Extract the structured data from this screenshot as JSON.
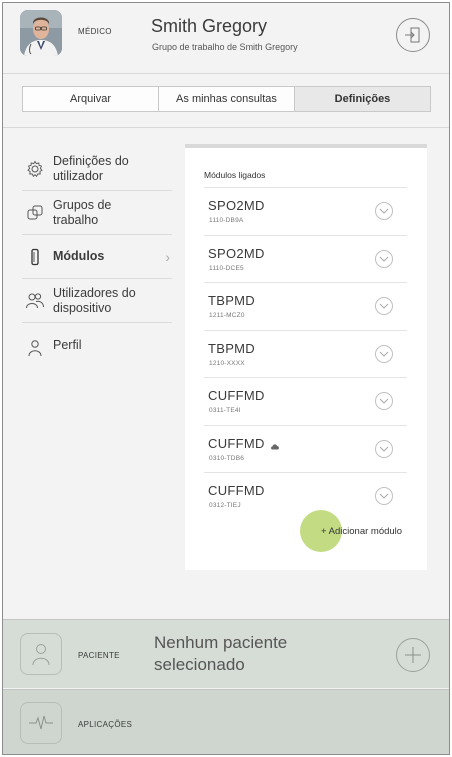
{
  "header": {
    "role": "MÉDICO",
    "user_name": "Smith Gregory",
    "group": "Grupo de trabalho de Smith Gregory"
  },
  "tabs": [
    {
      "label": "Arquivar",
      "active": false
    },
    {
      "label": "As minhas consultas",
      "active": false
    },
    {
      "label": "Definições",
      "active": true
    }
  ],
  "sidebar": {
    "items": [
      {
        "label": "Definições do utilizador",
        "icon": "gear-icon",
        "active": false
      },
      {
        "label": "Grupos de trabalho",
        "icon": "workgroup-icon",
        "active": false
      },
      {
        "label": "Módulos",
        "icon": "module-icon",
        "active": true
      },
      {
        "label": "Utilizadores do dispositivo",
        "icon": "users-icon",
        "active": false
      },
      {
        "label": "Perfil",
        "icon": "person-icon",
        "active": false
      }
    ]
  },
  "modules": {
    "title": "Módulos ligados",
    "items": [
      {
        "name": "SPO2MD",
        "id": "1110-DB9A"
      },
      {
        "name": "SPO2MD",
        "id": "1110-DCE5"
      },
      {
        "name": "TBPMD",
        "id": "1211-MCZ0"
      },
      {
        "name": "TBPMD",
        "id": "1210-XXXX"
      },
      {
        "name": "CUFFMD",
        "id": "0311-TE4I"
      },
      {
        "name": "CUFFMD",
        "id": "0310-TDB6",
        "cloud": true
      },
      {
        "name": "CUFFMD",
        "id": "0312-TIEJ"
      }
    ],
    "add_label": "+ Adicionar módulo"
  },
  "patient_bar": {
    "label": "PACIENTE",
    "status": "Nenhum paciente selecionado"
  },
  "apps_bar": {
    "label": "APLICAÇÕES"
  },
  "colors": {
    "accent_green": "#c3dc84",
    "bar_bg": "#d6ddd6"
  }
}
